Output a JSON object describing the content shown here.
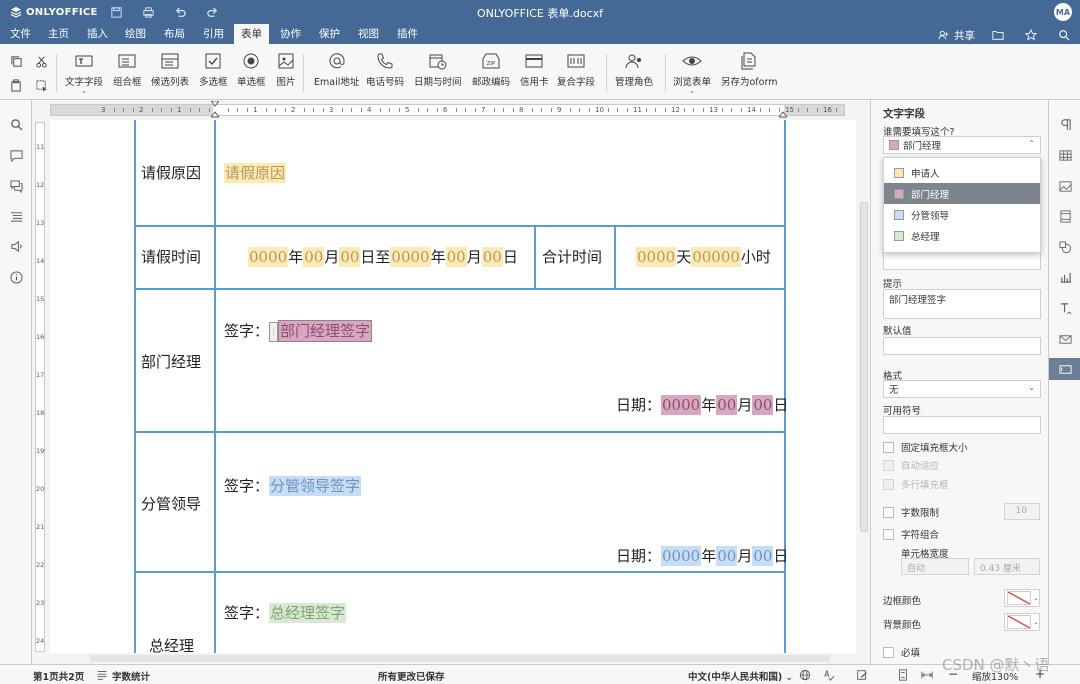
{
  "app": {
    "logo_text": "ONLYOFFICE",
    "document_title": "ONLYOFFICE 表单.docxf",
    "user_initials": "MA"
  },
  "menu": {
    "items": [
      "文件",
      "主页",
      "插入",
      "绘图",
      "布局",
      "引用",
      "表单",
      "协作",
      "保护",
      "视图",
      "插件"
    ],
    "active": "表单",
    "share_label": "共享"
  },
  "toolbar": {
    "tools": [
      {
        "label": "文字字段",
        "icon": "text-field-icon"
      },
      {
        "label": "组合框",
        "icon": "combo-box-icon"
      },
      {
        "label": "候选列表",
        "icon": "dropdown-list-icon"
      },
      {
        "label": "多选框",
        "icon": "checkbox-icon"
      },
      {
        "label": "单选框",
        "icon": "radio-button-icon"
      },
      {
        "label": "图片",
        "icon": "image-icon"
      },
      {
        "label": "Email地址",
        "icon": "email-icon"
      },
      {
        "label": "电话号码",
        "icon": "phone-icon"
      },
      {
        "label": "日期与时间",
        "icon": "datetime-icon"
      },
      {
        "label": "邮政编码",
        "icon": "zip-code-icon"
      },
      {
        "label": "信用卡",
        "icon": "credit-card-icon"
      },
      {
        "label": "复合字段",
        "icon": "complex-field-icon"
      },
      {
        "label": "管理角色",
        "icon": "manage-roles-icon"
      },
      {
        "label": "浏览表单",
        "icon": "view-form-icon"
      },
      {
        "label": "另存为oform",
        "icon": "save-oform-icon"
      }
    ]
  },
  "document": {
    "rows": {
      "reason": {
        "label": "请假原因",
        "field": "请假原因"
      },
      "time": {
        "label": "请假时间",
        "start_year": "0000",
        "nian": "年",
        "start_month": "00",
        "yue": "月",
        "start_day": "00",
        "ri_zhi": "日至",
        "end_year": "0000",
        "end_month": "00",
        "end_day": "00",
        "ri": "日",
        "total_label": "合计时间",
        "days": "0000",
        "tian": "天",
        "hours": "00000",
        "xiaoshi": "小时"
      },
      "dept_manager": {
        "label": "部门经理",
        "sign_label": "签字：",
        "sign_field": "部门经理签字",
        "date_label": "日期：",
        "year": "0000",
        "month": "00",
        "day": "00"
      },
      "division_leader": {
        "label": "分管领导",
        "sign_label": "签字：",
        "sign_field": "分管领导签字",
        "date_label": "日期：",
        "year": "0000",
        "month": "00",
        "day": "00"
      },
      "general_manager": {
        "label": "总经理",
        "sign_label": "签字：",
        "sign_field": "总经理签字"
      }
    }
  },
  "right_panel": {
    "title": "文字字段",
    "who_label": "谁需要填写这个?",
    "selected_role": "部门经理",
    "roles": [
      {
        "name": "申请人",
        "color": "#fce9b4"
      },
      {
        "name": "部门经理",
        "color": "#d9a6c0"
      },
      {
        "name": "分管领导",
        "color": "#c7dcf5"
      },
      {
        "name": "总经理",
        "color": "#d5ead0"
      }
    ],
    "hint_label": "提示",
    "hint_value": "部门经理签字",
    "default_label": "默认值",
    "default_value": "",
    "format_label": "格式",
    "format_value": "无",
    "allowed_symbols_label": "可用符号",
    "fixed_size_label": "固定填充框大小",
    "autofit_label": "自动适应",
    "multiline_label": "多行填充框",
    "char_limit_label": "字数限制",
    "char_limit_value": "10",
    "comb_label": "字符组合",
    "cell_width_label": "单元格宽度",
    "cell_width_mode": "自动",
    "cell_width_value": "0.43 厘米",
    "border_color_label": "边框颜色",
    "bg_color_label": "背景颜色",
    "required_label": "必填"
  },
  "statusbar": {
    "page_info": "第1页共2页",
    "word_count": "字数统计",
    "save_status": "所有更改已保存",
    "language": "中文(中华人民共和国)",
    "zoom": "缩放130%"
  },
  "watermark": "CSDN @默丶语",
  "colors": {
    "header_blue": "#446995",
    "table_border": "#5b9bd5"
  }
}
